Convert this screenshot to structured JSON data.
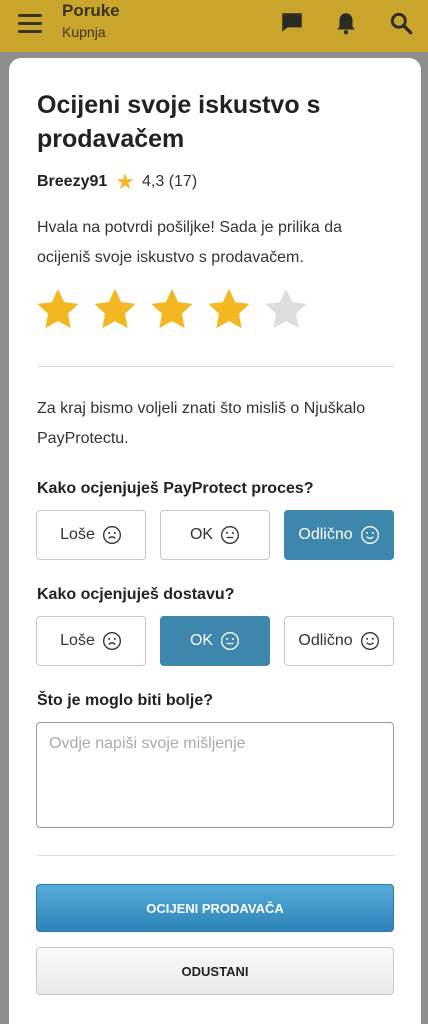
{
  "topbar": {
    "title": "Poruke",
    "subtitle": "Kupnja",
    "color": "#c9a52b"
  },
  "icons": [
    "menu-icon",
    "chat-icon",
    "bell-icon",
    "search-icon"
  ],
  "dialog": {
    "title": "Ocijeni svoje iskustvo s prodavačem",
    "seller": {
      "name": "Breezy91",
      "rating": "4,3 (17)"
    },
    "intro": "Hvala na potvrdi pošiljke! Sada je prilika da ocijeniš svoje iskustvo s prodavačem.",
    "star_rating": 4,
    "star_max": 5,
    "closing": "Za kraj bismo voljeli znati što misliš o Njuškalo PayProtectu.",
    "questions": [
      {
        "label": "Kako ocjenjuješ PayProtect proces?",
        "options": [
          "Loše",
          "OK",
          "Odlično"
        ],
        "selected": "Odlično"
      },
      {
        "label": "Kako ocjenjuješ dostavu?",
        "options": [
          "Loše",
          "OK",
          "Odlično"
        ],
        "selected": "OK"
      }
    ],
    "feedback": {
      "label": "Što je moglo biti bolje?",
      "placeholder": "Ovdje napiši svoje mišljenje"
    },
    "submit_label": "OCIJENI PRODAVAČA",
    "cancel_label": "ODUSTANI"
  },
  "colors": {
    "accent": "#3d86ac",
    "star_filled": "#f3b722",
    "star_empty": "#dddddd"
  }
}
